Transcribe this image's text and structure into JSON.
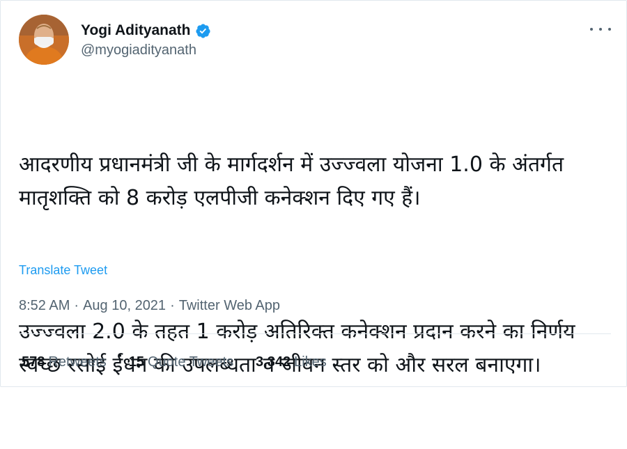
{
  "colors": {
    "accent": "#1d9bf0",
    "text": "#0f1419",
    "muted": "#536471",
    "divider": "#e1e8ed"
  },
  "author": {
    "name": "Yogi Adityanath",
    "handle": "@myogiadityanath",
    "verified": true,
    "avatar_icon": "profile-photo"
  },
  "tweet": {
    "paragraphs": [
      "आदरणीय प्रधानमंत्री जी के मार्गदर्शन में उज्ज्वला योजना 1.0 के अंतर्गत मातृशक्ति को 8 करोड़ एलपीजी कनेक्शन दिए गए हैं।",
      "उज्ज्वला 2.0 के तहत 1 करोड़ अतिरिक्त कनेक्शन प्रदान करने का निर्णय स्वच्छ रसोई ईंधन की उपलब्धता व जीवन स्तर को और सरल बनाएगा।"
    ],
    "translate_label": "Translate Tweet"
  },
  "meta": {
    "time": "8:52 AM",
    "date": "Aug 10, 2021",
    "source": "Twitter Web App",
    "separator": "·"
  },
  "stats": {
    "retweets_count": "578",
    "retweets_label": "Retweets",
    "quotes_count": "15",
    "quotes_label": "Quote Tweets",
    "likes_count": "3,342",
    "likes_label": "Likes"
  },
  "icons": {
    "verified": "verified-badge-icon",
    "more": "more-options-icon"
  }
}
